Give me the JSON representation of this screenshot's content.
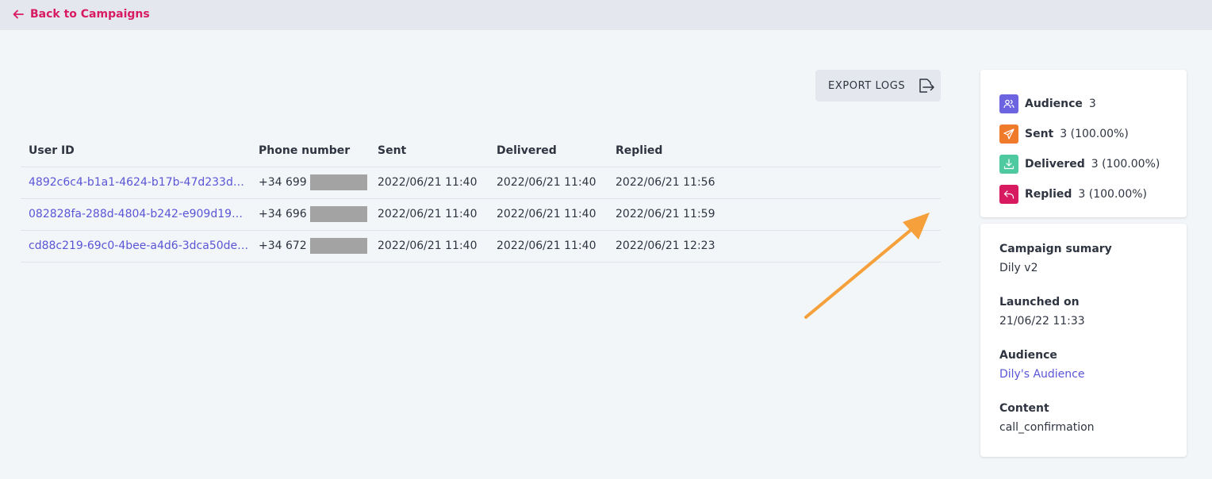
{
  "header": {
    "back_label": "Back to Campaigns"
  },
  "toolbar": {
    "export_label": "EXPORT LOGS"
  },
  "table": {
    "headers": [
      "User ID",
      "Phone number",
      "Sent",
      "Delivered",
      "Replied"
    ],
    "rows": [
      {
        "user_id": "4892c6c4-b1a1-4624-b17b-47d233d94...",
        "phone": "+34 699",
        "sent": "2022/06/21 11:40",
        "delivered": "2022/06/21 11:40",
        "replied": "2022/06/21 11:56"
      },
      {
        "user_id": "082828fa-288d-4804-b242-e909d19ee...",
        "phone": "+34 696",
        "sent": "2022/06/21 11:40",
        "delivered": "2022/06/21 11:40",
        "replied": "2022/06/21 11:59"
      },
      {
        "user_id": "cd88c219-69c0-4bee-a4d6-3dca50de0...",
        "phone": "+34 672",
        "sent": "2022/06/21 11:40",
        "delivered": "2022/06/21 11:40",
        "replied": "2022/06/21 12:23"
      }
    ]
  },
  "stats": [
    {
      "label": "Audience",
      "value": "3",
      "icon": "users-icon",
      "color": "#6b63e0"
    },
    {
      "label": "Sent",
      "value": "3 (100.00%)",
      "icon": "paper-plane-icon",
      "color": "#f07a2c"
    },
    {
      "label": "Delivered",
      "value": "3 (100.00%)",
      "icon": "download-icon",
      "color": "#4fc9a0"
    },
    {
      "label": "Replied",
      "value": "3 (100.00%)",
      "icon": "reply-icon",
      "color": "#d81b60"
    }
  ],
  "summary": {
    "campaign_label": "Campaign sumary",
    "campaign_value": "Dily v2",
    "launched_label": "Launched on",
    "launched_value": "21/06/22 11:33",
    "audience_label": "Audience",
    "audience_value": "Dily's Audience",
    "content_label": "Content",
    "content_value": "call_confirmation"
  },
  "colors": {
    "accent": "#d81b60",
    "link": "#5a55d6",
    "annotation_arrow": "#f5a03a"
  }
}
